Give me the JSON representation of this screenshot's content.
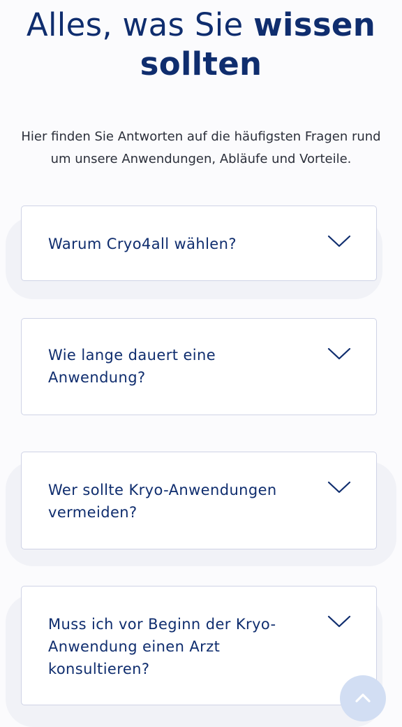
{
  "heading": {
    "light": "Alles, was Sie ",
    "bold_line1": "wissen",
    "bold_line2": "sollten"
  },
  "subtitle": "Hier finden Sie Antworten auf die häufigsten Fragen rund um unsere Anwendungen, Abläufe und Vorteile.",
  "faq": [
    {
      "question": "Warum Cryo4all wählen?",
      "expanded": false
    },
    {
      "question": "Wie lange dauert eine Anwendung?",
      "expanded": false
    },
    {
      "question": "Wer sollte Kryo-Anwendungen vermeiden?",
      "expanded": false
    },
    {
      "question": "Muss ich vor Beginn der Kryo-Anwendung einen Arzt konsultieren?",
      "expanded": false
    }
  ],
  "icons": {
    "faq_toggle": "chevron-down-icon",
    "scroll_top": "chevron-up-icon"
  },
  "colors": {
    "primary": "#0f2d6e",
    "card_border": "#cfd3e6",
    "scroll_button": "#d2def3"
  }
}
